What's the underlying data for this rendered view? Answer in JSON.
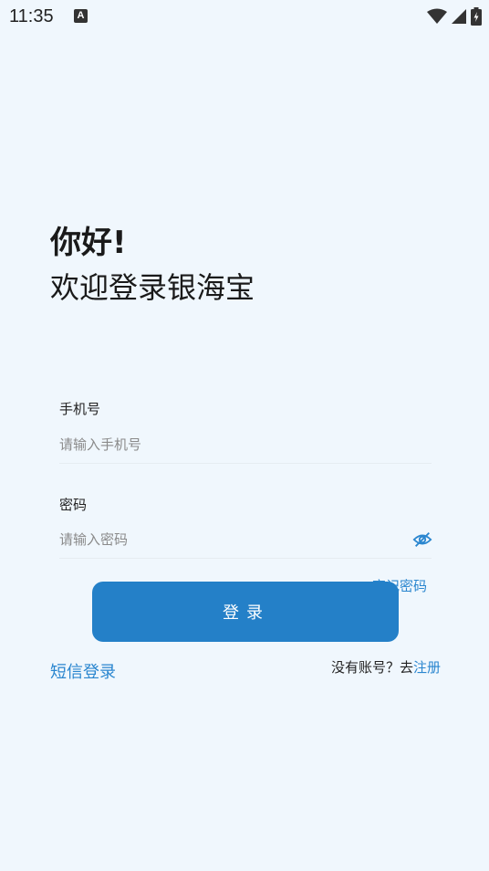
{
  "status_bar": {
    "time": "11:35",
    "notification_icon": "A"
  },
  "header": {
    "greeting": "你好!",
    "welcome": "欢迎登录银海宝"
  },
  "form": {
    "phone": {
      "label": "手机号",
      "value": "",
      "placeholder": "请输入手机号"
    },
    "password": {
      "label": "密码",
      "value": "",
      "placeholder": "请输入密码"
    },
    "forgot_label": "忘记密码",
    "login_label": "登录"
  },
  "footer": {
    "sms_login_label": "短信登录",
    "no_account_text": "没有账号？去",
    "register_label": "注册"
  },
  "colors": {
    "background": "#f0f7fd",
    "accent": "#2480c8",
    "link": "#2a86cf"
  },
  "icons": [
    "wifi-icon",
    "signal-icon",
    "battery-icon",
    "eye-off-icon"
  ]
}
